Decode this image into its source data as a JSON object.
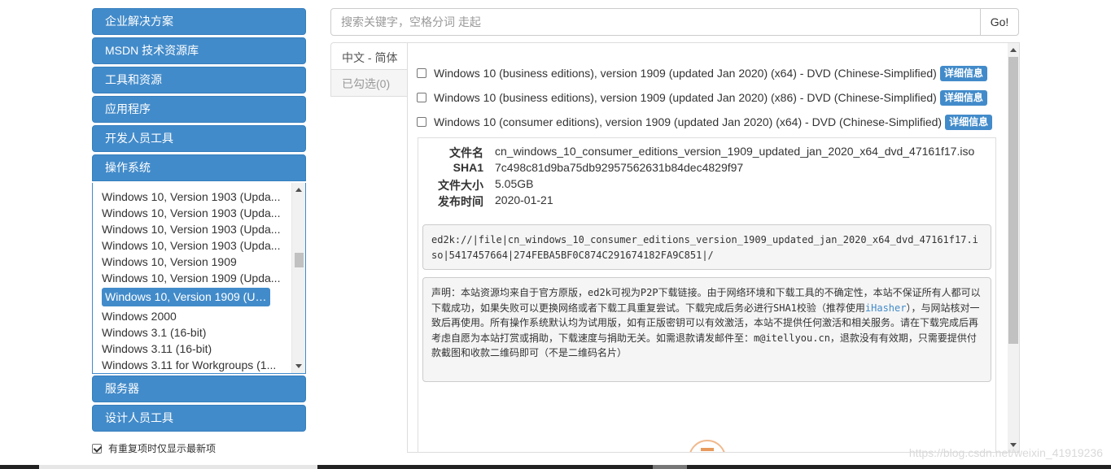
{
  "sidebar": {
    "categories": [
      {
        "label": "企业解决方案"
      },
      {
        "label": "MSDN 技术资源库"
      },
      {
        "label": "工具和资源"
      },
      {
        "label": "应用程序"
      },
      {
        "label": "开发人员工具"
      },
      {
        "label": "操作系统"
      },
      {
        "label": "服务器"
      },
      {
        "label": "设计人员工具"
      }
    ],
    "os_items": [
      "Windows 10, Version 1903 (Upda...",
      "Windows 10, Version 1903 (Upda...",
      "Windows 10, Version 1903 (Upda...",
      "Windows 10, Version 1903 (Upda...",
      "Windows 10, Version 1909",
      "Windows 10, Version 1909 (Upda...",
      "Windows 10, Version 1909 (Upd...",
      "Windows 2000",
      "Windows 3.1 (16-bit)",
      "Windows 3.11 (16-bit)",
      "Windows 3.11 for Workgroups (1..."
    ],
    "selected_index": 6,
    "dedupe_label": "有重复项时仅显示最新项"
  },
  "search": {
    "placeholder": "搜索关键字，空格分词 走起",
    "button": "Go!"
  },
  "tabs": {
    "language": "中文 - 简体",
    "selected": "已勾选(0)"
  },
  "files": [
    {
      "name": "Windows 10 (business editions), version 1909 (updated Jan 2020) (x64) - DVD (Chinese-Simplified)",
      "badge": "详细信息"
    },
    {
      "name": "Windows 10 (business editions), version 1909 (updated Jan 2020) (x86) - DVD (Chinese-Simplified)",
      "badge": "详细信息"
    },
    {
      "name": "Windows 10 (consumer editions), version 1909 (updated Jan 2020) (x64) - DVD (Chinese-Simplified)",
      "badge": "详细信息"
    }
  ],
  "detail": {
    "filename_label": "文件名",
    "filename": "cn_windows_10_consumer_editions_version_1909_updated_jan_2020_x64_dvd_47161f17.iso",
    "sha1_label": "SHA1",
    "sha1": "7c498c81d9ba75db92957562631b84dec4829f97",
    "size_label": "文件大小",
    "size": "5.05GB",
    "date_label": "发布时间",
    "date": "2020-01-21",
    "ed2k": "ed2k://|file|cn_windows_10_consumer_editions_version_1909_updated_jan_2020_x64_dvd_47161f17.iso|5417457664|274FEBA5BF0C874C291674182FA9C851|/",
    "notice_part1": "声明：本站资源均来自于官方原版，ed2k可视为P2P下载链接。由于网络环境和下载工具的不确定性，本站不保证所有人都可以下载成功，如果失败可以更换网络或者下载工具重复尝试。下载完成后务必进行SHA1校验（推荐使用",
    "notice_link": "iHasher",
    "notice_part2": "），与网站核对一致后再使用。所有操作系统默认均为试用版，如有正版密钥可以有效激活，本站不提供任何激活和相关服务。请在下载完成后再考虑自愿为本站打赏或捐助，下载速度与捐助无关。如需退款请发邮件至：m@itellyou.cn，退款没有有效期，只需要提供付款截图和收款二维码即可（不是二维码名片）"
  },
  "watermark": "https://blog.csdn.net/weixin_41919236",
  "colors": {
    "primary": "#428bca",
    "border": "#dddddd",
    "pre_bg": "#f5f5f5"
  }
}
